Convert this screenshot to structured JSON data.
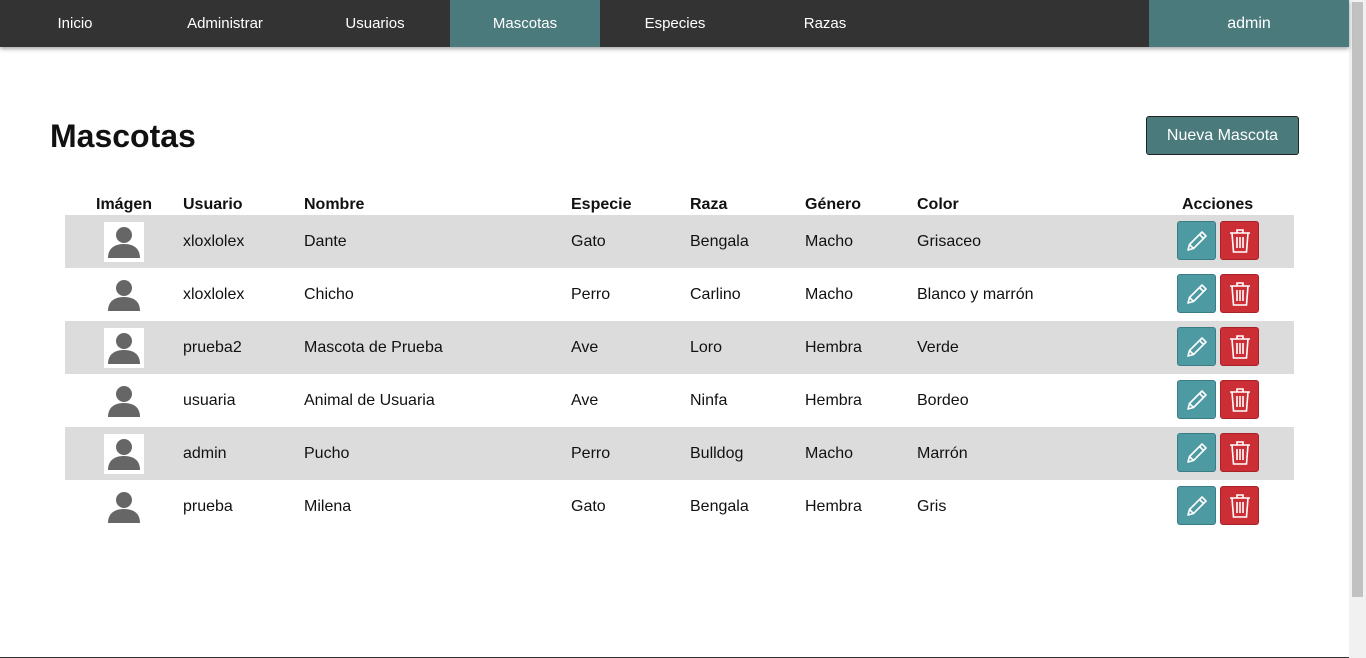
{
  "nav": {
    "items": [
      {
        "label": "Inicio"
      },
      {
        "label": "Administrar"
      },
      {
        "label": "Usuarios"
      },
      {
        "label": "Mascotas",
        "active": true
      },
      {
        "label": "Especies"
      },
      {
        "label": "Razas"
      }
    ],
    "user": "admin"
  },
  "page": {
    "title": "Mascotas",
    "new_button": "Nueva Mascota"
  },
  "table": {
    "headers": {
      "image": "Imágen",
      "user": "Usuario",
      "name": "Nombre",
      "species": "Especie",
      "breed": "Raza",
      "gender": "Género",
      "color": "Color",
      "actions": "Acciones"
    },
    "rows": [
      {
        "user": "xloxlolex",
        "name": "Dante",
        "species": "Gato",
        "breed": "Bengala",
        "gender": "Macho",
        "color": "Grisaceo"
      },
      {
        "user": "xloxlolex",
        "name": "Chicho",
        "species": "Perro",
        "breed": "Carlino",
        "gender": "Macho",
        "color": "Blanco y marrón"
      },
      {
        "user": "prueba2",
        "name": "Mascota de Prueba",
        "species": "Ave",
        "breed": "Loro",
        "gender": "Hembra",
        "color": "Verde"
      },
      {
        "user": "usuaria",
        "name": "Animal de Usuaria",
        "species": "Ave",
        "breed": "Ninfa",
        "gender": "Hembra",
        "color": "Bordeo"
      },
      {
        "user": "admin",
        "name": "Pucho",
        "species": "Perro",
        "breed": "Bulldog",
        "gender": "Macho",
        "color": "Marrón"
      },
      {
        "user": "prueba",
        "name": "Milena",
        "species": "Gato",
        "breed": "Bengala",
        "gender": "Hembra",
        "color": "Gris"
      }
    ]
  },
  "icons": {
    "avatar": "user-avatar-icon",
    "edit": "pencil-icon",
    "delete": "trash-icon"
  },
  "colors": {
    "navbar": "#333333",
    "accent": "#4a7a7c",
    "edit_button": "#4d9aa3",
    "delete_button": "#cc2e35",
    "row_shade": "#dcdcdc"
  }
}
